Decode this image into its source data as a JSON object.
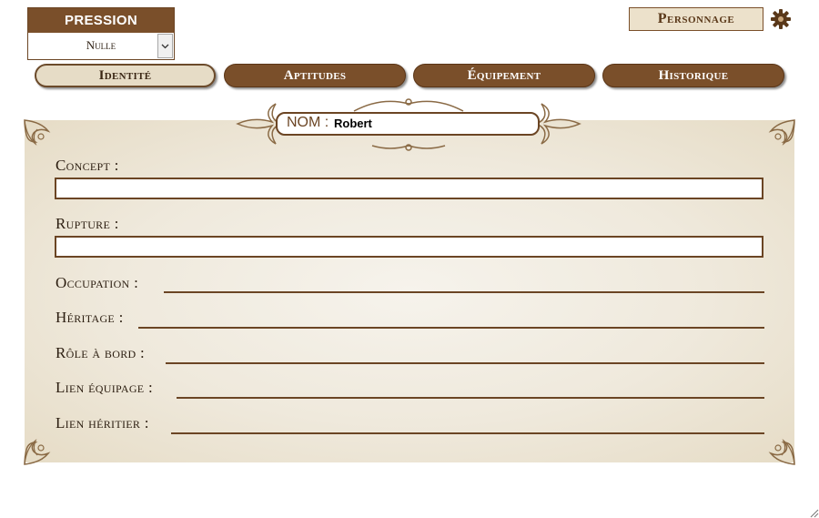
{
  "pression": {
    "title": "PRESSION",
    "selected": "Nulle"
  },
  "header": {
    "personnage_label": "Personnage"
  },
  "tabs": [
    {
      "label": "Identité",
      "active": true
    },
    {
      "label": "Aptitudes",
      "active": false
    },
    {
      "label": "Équipement",
      "active": false
    },
    {
      "label": "Historique",
      "active": false
    }
  ],
  "identity": {
    "nom_label": "NOM :",
    "nom_value": "Robert",
    "concept_label": "Concept :",
    "concept_value": "",
    "rupture_label": "Rupture :",
    "rupture_value": "",
    "occupation_label": "Occupation :",
    "heritage_label": "Héritage :",
    "role_label": "Rôle à bord :",
    "lien_equipage_label": "Lien équipage :",
    "lien_heritier_label": "Lien héritier :"
  },
  "colors": {
    "brown": "#7a4f2a",
    "parchment": "#efe9dc",
    "border": "#6b4524"
  },
  "icons": {
    "settings": "gear-icon",
    "dropdown": "chevron-down-icon",
    "resize": "resize-grip-icon"
  }
}
